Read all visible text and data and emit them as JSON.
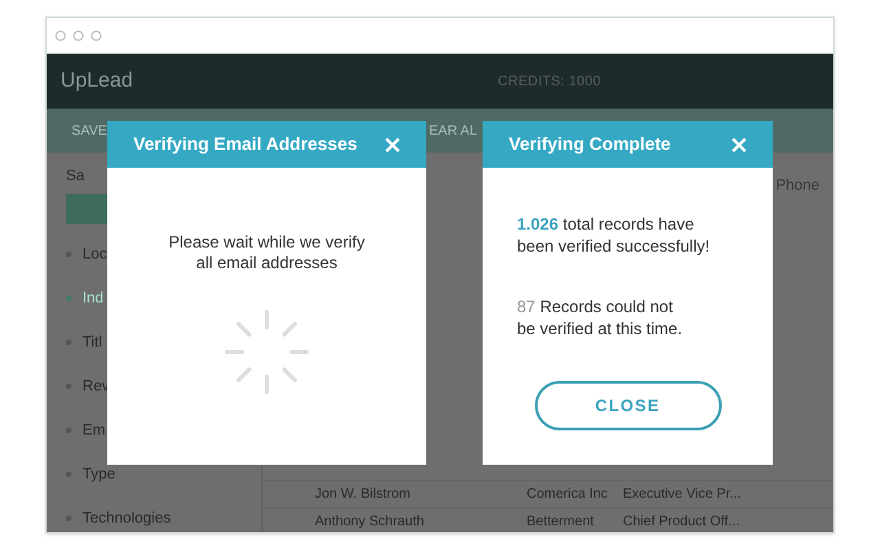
{
  "app": {
    "logo": "UpLead",
    "credits": "CREDITS: 1000"
  },
  "toolbar": {
    "save": "SAVE",
    "clear": "EAR AL"
  },
  "sidebar": {
    "search_placeholder": "Sa",
    "items": [
      {
        "label": "Loc",
        "selected": false
      },
      {
        "label": "Ind",
        "selected": true
      },
      {
        "label": "Titl",
        "selected": false
      },
      {
        "label": "Rev",
        "selected": false
      },
      {
        "label": "Em",
        "selected": false
      },
      {
        "label": "Type",
        "selected": false
      },
      {
        "label": "Technologies",
        "selected": false
      }
    ]
  },
  "table": {
    "columns": [
      {
        "label": "Phone"
      }
    ],
    "rows": [
      {
        "name": "Jon W. Bilstrom",
        "company": "Comerica Inc",
        "title": "Executive Vice Pr..."
      },
      {
        "name": "Anthony Schrauth",
        "company": "Betterment",
        "title": "Chief Product Off..."
      }
    ]
  },
  "dialogs": [
    {
      "kind": "progress",
      "title": "Verifying Email Addresses",
      "message": "Please wait while we verify all email addresses"
    },
    {
      "kind": "result",
      "title": "Verifying Complete",
      "success_count": "1.026",
      "success_text": "total records have been verified successfully!",
      "fail_count": "87",
      "fail_text": "Records could not be verified at this time.",
      "button": "CLOSE"
    }
  ]
}
